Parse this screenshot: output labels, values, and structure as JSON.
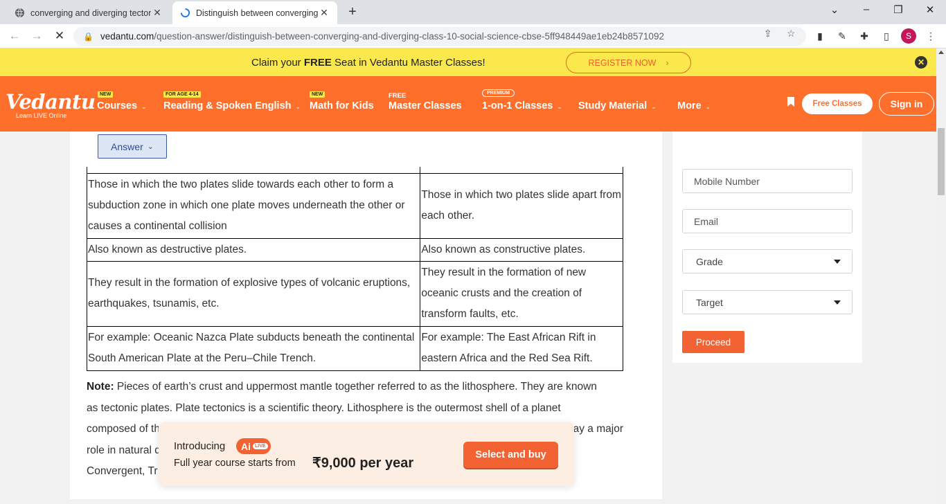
{
  "browser": {
    "tabs": [
      {
        "title": "converging and diverging tecton",
        "active": false
      },
      {
        "title": "Distinguish between converging",
        "active": true
      }
    ],
    "url_domain": "vedantu.com",
    "url_path": "/question-answer/distinguish-between-converging-and-diverging-class-10-social-science-cbse-5ff948449ae1eb24b8571092",
    "profile_initial": "S"
  },
  "promo": {
    "prefix": "Claim your ",
    "bold": "FREE",
    "suffix": " Seat in Vedantu Master Classes!",
    "register_label": "REGISTER NOW"
  },
  "nav": {
    "logo": "Vedantu",
    "logo_tagline": "Learn LIVE Online",
    "items": [
      {
        "label": "Courses",
        "badge": "NEW"
      },
      {
        "label": "Reading & Spoken English",
        "badge": "FOR AGE 4-14"
      },
      {
        "label": "Math for Kids",
        "badge": "NEW"
      },
      {
        "label": "Master Classes",
        "badge": "FREE"
      },
      {
        "label": "1-on-1 Classes",
        "badge": "PREMIUM"
      },
      {
        "label": "Study Material",
        "badge": ""
      },
      {
        "label": "More",
        "badge": ""
      }
    ],
    "free_classes": "Free Classes",
    "sign_in": "Sign in"
  },
  "answer_button": "Answer",
  "table": {
    "rows": [
      [
        "Those in which the two plates slide towards each other to form a subduction zone in which one plate moves underneath the other or causes a continental collision",
        "Those in which two plates slide apart from each other."
      ],
      [
        "Also known as destructive plates.",
        "Also known as constructive plates."
      ],
      [
        "They result in the formation of explosive types of volcanic eruptions, earthquakes, tsunamis, etc.",
        "They result in the formation of new oceanic crusts and the creation of transform faults, etc."
      ],
      [
        "For example: Oceanic Nazca Plate subducts beneath the continental South American Plate at the Peru–Chile Trench.",
        "For example: The East African Rift in eastern Africa and the Red Sea Rift."
      ]
    ]
  },
  "note": {
    "label": "Note:",
    "line1": " Pieces of earth’s crust and uppermost mantle together referred to as the lithosphere. They are known",
    "line2": "as tectonic plates. Plate tectonics is a scientific theory. Lithosphere is the outermost shell of a planet",
    "line3_start": "composed of th",
    "line3_end": "ay a major",
    "line4_start": "role in natural d",
    "line5_start": "Convergent, Tr"
  },
  "form": {
    "mobile_placeholder": "Mobile Number",
    "email_placeholder": "Email",
    "grade": "Grade",
    "target": "Target",
    "proceed": "Proceed"
  },
  "popup": {
    "introducing": "Introducing",
    "ai": "Ai",
    "live": "LIVE",
    "line2": "Full year course starts from",
    "price": "₹9,000 per year",
    "cta": "Select and buy"
  },
  "colors": {
    "brand_orange": "#ff6f2c",
    "promo_yellow": "#fbe84c",
    "cta_orange": "#f26232"
  }
}
